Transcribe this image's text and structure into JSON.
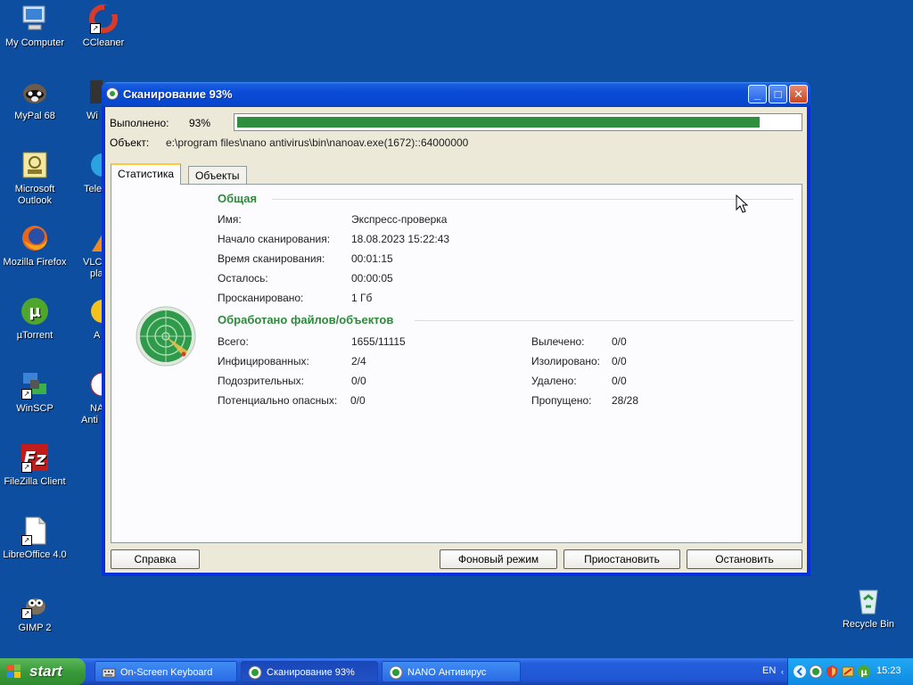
{
  "desktop": {
    "icons": [
      {
        "label": "My Computer"
      },
      {
        "label": "CCleaner"
      },
      {
        "label": "MyPal 68"
      },
      {
        "label": "Wi"
      },
      {
        "label": "Microsoft Outlook"
      },
      {
        "label": "Tele"
      },
      {
        "label": "Mozilla Firefox"
      },
      {
        "label": "VLC"
      },
      {
        "label": "pla"
      },
      {
        "label": "µTorrent"
      },
      {
        "label": "A"
      },
      {
        "label": "WinSCP"
      },
      {
        "label": "NA"
      },
      {
        "label": "Anti"
      },
      {
        "label": "FileZilla Client"
      },
      {
        "label": "LibreOffice 4.0"
      },
      {
        "label": "GIMP 2"
      },
      {
        "label": "Recycle Bin"
      }
    ]
  },
  "window": {
    "title": "Сканирование 93%",
    "progress_label": "Выполнено:",
    "progress_value": "93%",
    "progress_fraction": 0.93,
    "object_label": "Объект:",
    "object_value": "e:\\program files\\nano antivirus\\bin\\nanoav.exe(1672)::64000000",
    "tabs": [
      {
        "label": "Статистика",
        "active": true
      },
      {
        "label": "Объекты",
        "active": false
      }
    ],
    "section_general": "Общая",
    "general": [
      {
        "label": "Имя:",
        "value": "Экспресс-проверка"
      },
      {
        "label": "Начало сканирования:",
        "value": "18.08.2023 15:22:43"
      },
      {
        "label": "Время сканирования:",
        "value": "00:01:15"
      },
      {
        "label": "Осталось:",
        "value": "00:00:05"
      },
      {
        "label": "Просканировано:",
        "value": "1 Гб"
      }
    ],
    "section_processed": "Обработано файлов/объектов",
    "processed_left": [
      {
        "label": "Всего:",
        "value": "1655/11115"
      },
      {
        "label": "Инфицированных:",
        "value": "2/4"
      },
      {
        "label": "Подозрительных:",
        "value": "0/0"
      },
      {
        "label": "Потенциально опасных:",
        "value": "0/0"
      }
    ],
    "processed_right": [
      {
        "label": "Вылечено:",
        "value": "0/0"
      },
      {
        "label": "Изолировано:",
        "value": "0/0"
      },
      {
        "label": "Удалено:",
        "value": "0/0"
      },
      {
        "label": "Пропущено:",
        "value": "28/28"
      }
    ],
    "buttons": {
      "help": "Справка",
      "background": "Фоновый режим",
      "pause": "Приостановить",
      "stop": "Остановить"
    }
  },
  "taskbar": {
    "start": "start",
    "tasks": [
      {
        "label": "On-Screen Keyboard",
        "active": false
      },
      {
        "label": "Сканирование 93%",
        "active": true
      },
      {
        "label": "NANO Антивирус",
        "active": false
      }
    ],
    "language": "EN",
    "clock": "15:23"
  },
  "colors": {
    "desktop": "#0e4ea1",
    "progress": "#2f8f3f",
    "section_heading": "#2c8a3a"
  }
}
